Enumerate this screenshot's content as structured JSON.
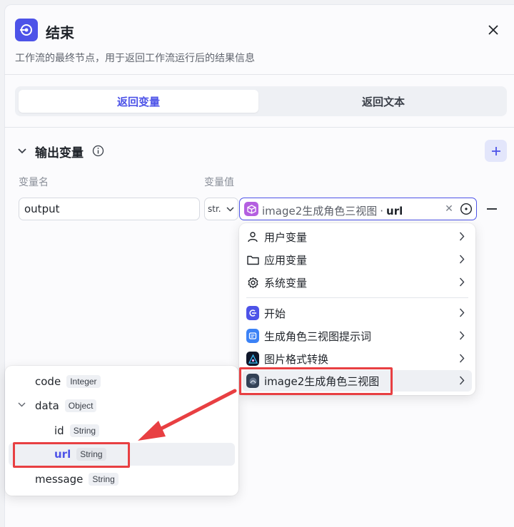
{
  "header": {
    "title": "结束",
    "description": "工作流的最终节点，用于返回工作流运行后的结果信息"
  },
  "tabs": [
    {
      "label": "返回变量",
      "active": true
    },
    {
      "label": "返回文本",
      "active": false
    }
  ],
  "section": {
    "title": "输出变量",
    "columns": {
      "name": "变量名",
      "value": "变量值"
    }
  },
  "row": {
    "name": "output",
    "type": "str.",
    "value_node": "image2生成角色三视图",
    "value_sep": "·",
    "value_field": "url"
  },
  "dropdown": {
    "groups": [
      {
        "label": "用户变量",
        "icon": "user-icon"
      },
      {
        "label": "应用变量",
        "icon": "folder-icon"
      },
      {
        "label": "系统变量",
        "icon": "gear-icon"
      }
    ],
    "nodes": [
      {
        "label": "开始",
        "icon": "start-node-icon",
        "color": "#4d53e8"
      },
      {
        "label": "生成角色三视图提示词",
        "icon": "llm-node-icon",
        "color": "#3b82f6"
      },
      {
        "label": "图片格式转换",
        "icon": "image-convert-node-icon",
        "color": "#0f172a"
      },
      {
        "label": "image2生成角色三视图",
        "icon": "image2-node-icon",
        "color": "#334155",
        "highlighted": true
      }
    ]
  },
  "subfields": [
    {
      "name": "code",
      "type": "Integer",
      "level": 0
    },
    {
      "name": "data",
      "type": "Object",
      "level": 0,
      "expanded": true
    },
    {
      "name": "id",
      "type": "String",
      "level": 1
    },
    {
      "name": "url",
      "type": "String",
      "level": 1,
      "selected": true
    },
    {
      "name": "message",
      "type": "String",
      "level": 0
    }
  ],
  "colors": {
    "accent": "#4d53e8",
    "annotation": "#e83f42"
  }
}
